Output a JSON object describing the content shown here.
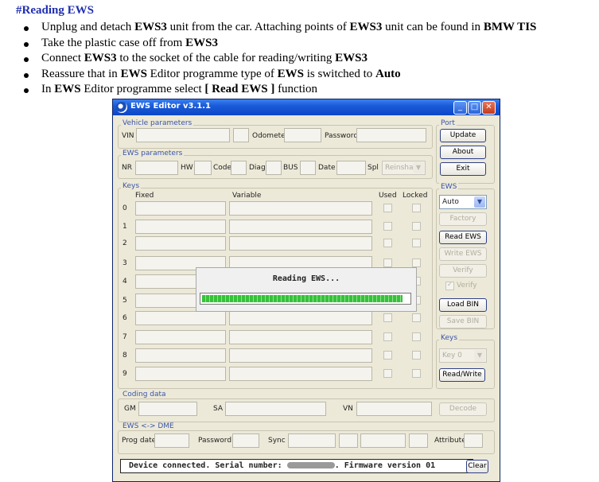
{
  "doc": {
    "title": "#Reading EWS",
    "items": [
      [
        {
          "t": "Unplug and detach "
        },
        {
          "t": "EWS3",
          "b": true
        },
        {
          "t": " unit from the car. Attaching points of "
        },
        {
          "t": "EWS3",
          "b": true
        },
        {
          "t": " unit can be found in "
        },
        {
          "t": "BMW TIS",
          "b": true
        }
      ],
      [
        {
          "t": "Take the plastic case off from "
        },
        {
          "t": "EWS3",
          "b": true
        }
      ],
      [
        {
          "t": "Connect "
        },
        {
          "t": "EWS3",
          "b": true
        },
        {
          "t": " to the socket of the cable for reading/writing "
        },
        {
          "t": "EWS3",
          "b": true
        }
      ],
      [
        {
          "t": "Reassure that in "
        },
        {
          "t": "EWS",
          "b": true
        },
        {
          "t": " Editor programme type of "
        },
        {
          "t": "EWS",
          "b": true
        },
        {
          "t": " is switched to "
        },
        {
          "t": "Auto",
          "b": true
        }
      ],
      [
        {
          "t": "In "
        },
        {
          "t": "EWS",
          "b": true
        },
        {
          "t": " Editor programme select "
        },
        {
          "t": "[ Read EWS ]",
          "b": true
        },
        {
          "t": " function"
        }
      ]
    ]
  },
  "window": {
    "title": "EWS Editor v3.1.1",
    "controls": {
      "minimize": "_",
      "maximize": "□",
      "close": "✕"
    },
    "vehicle": {
      "group": "Vehicle parameters",
      "vin": "VIN",
      "odometer": "Odometer",
      "password": "Password"
    },
    "ews_params": {
      "group": "EWS parameters",
      "nr": "NR",
      "hw": "HW",
      "code": "Code",
      "diag": "Diag",
      "bus": "BUS",
      "date": "Date",
      "spl": "Spl",
      "spl_value": "Reinshag"
    },
    "keys": {
      "group": "Keys",
      "fixed": "Fixed",
      "variable": "Variable",
      "used": "Used",
      "locked": "Locked",
      "rows": [
        "0",
        "1",
        "2",
        "3",
        "4",
        "5",
        "6",
        "7",
        "8",
        "9"
      ]
    },
    "port": {
      "group": "Port",
      "update": "Update",
      "about": "About",
      "exit": "Exit"
    },
    "ews": {
      "group": "EWS",
      "type_value": "Auto",
      "factory": "Factory",
      "read_ews": "Read EWS",
      "write_ews": "Write EWS",
      "verify": "Verify",
      "verify_check": "Verify",
      "load_bin": "Load BIN",
      "save_bin": "Save BIN"
    },
    "right_keys": {
      "group": "Keys",
      "key_value": "Key 0",
      "read_write": "Read/Write"
    },
    "coding": {
      "group": "Coding data",
      "gm": "GM",
      "sa": "SA",
      "vn": "VN",
      "decode": "Decode"
    },
    "dme": {
      "group": "EWS <-> DME",
      "prog_date": "Prog date",
      "password": "Password",
      "sync": "Sync",
      "attribute": "Attribute"
    },
    "dialog": {
      "message": "Reading EWS...",
      "progress": 0.97
    },
    "status": {
      "before": "Device connected. Serial number: ",
      "after": ". Firmware version 01"
    },
    "clear": "Clear"
  },
  "colors": {
    "title_blue": "#1f2fb0",
    "progress_green": "#36c23a",
    "titlebar": "#1a5bd8"
  }
}
